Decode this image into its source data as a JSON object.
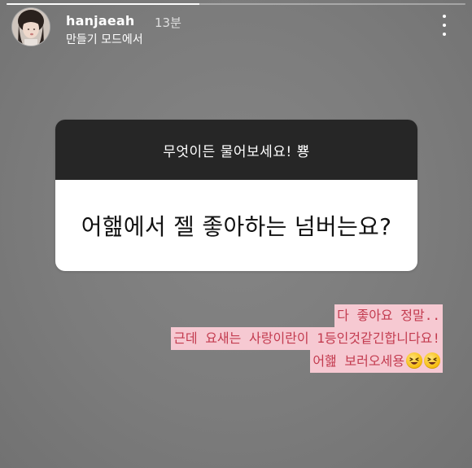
{
  "story": {
    "progress": 0.42,
    "background_color": "#7c7c7c"
  },
  "header": {
    "username": "hanjaeah",
    "timestamp": "13분",
    "subtitle": "만들기 모드에서",
    "menu_icon": "more-vertical-icon"
  },
  "question_sticker": {
    "prompt": "무엇이든 물어보세요! 뿅",
    "question": "어햂에서 젤 좋아하는 넘버는요?"
  },
  "reply": {
    "lines": [
      "다 좋아요 정말..",
      "근데 요새는 사랑이란이 1등인것같긴합니다요!",
      "어햂 보러오세용"
    ],
    "emoji": "laughing-squint-emoji",
    "emoji_count": 2,
    "text_color": "#c33b4f",
    "highlight_color": "#f6c9d2"
  }
}
